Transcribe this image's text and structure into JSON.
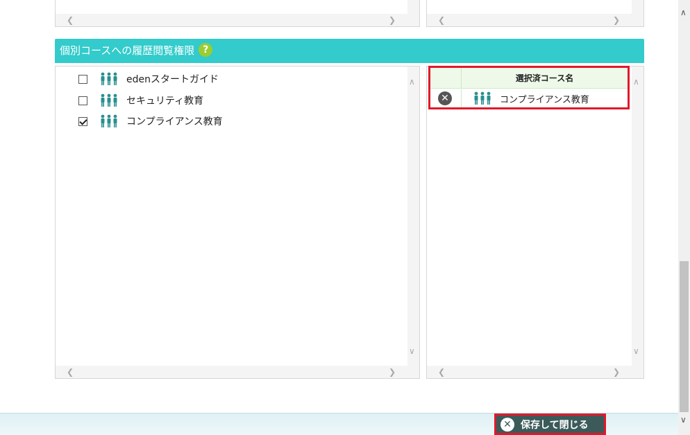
{
  "section": {
    "title": "個別コースへの履歴閲覧権限",
    "help_icon": "?"
  },
  "courses": [
    {
      "label": "edenスタートガイド",
      "checked": false
    },
    {
      "label": "セキュリティ教育",
      "checked": false
    },
    {
      "label": "コンプライアンス教育",
      "checked": true
    }
  ],
  "selected_table": {
    "header": "選択済コース名",
    "rows": [
      {
        "course": "コンプライアンス教育"
      }
    ]
  },
  "footer": {
    "save_close_label": "保存して閉じる"
  },
  "icons": {
    "group": "people-group-icon",
    "remove": "remove-circle-icon",
    "close": "close-circle-icon"
  },
  "colors": {
    "header_bg": "#33cbcb",
    "help_icon": "#9acd32",
    "people_icon": "#2a8f8f",
    "highlight_border": "#e0192a",
    "button_bg": "#3c5a5a"
  }
}
